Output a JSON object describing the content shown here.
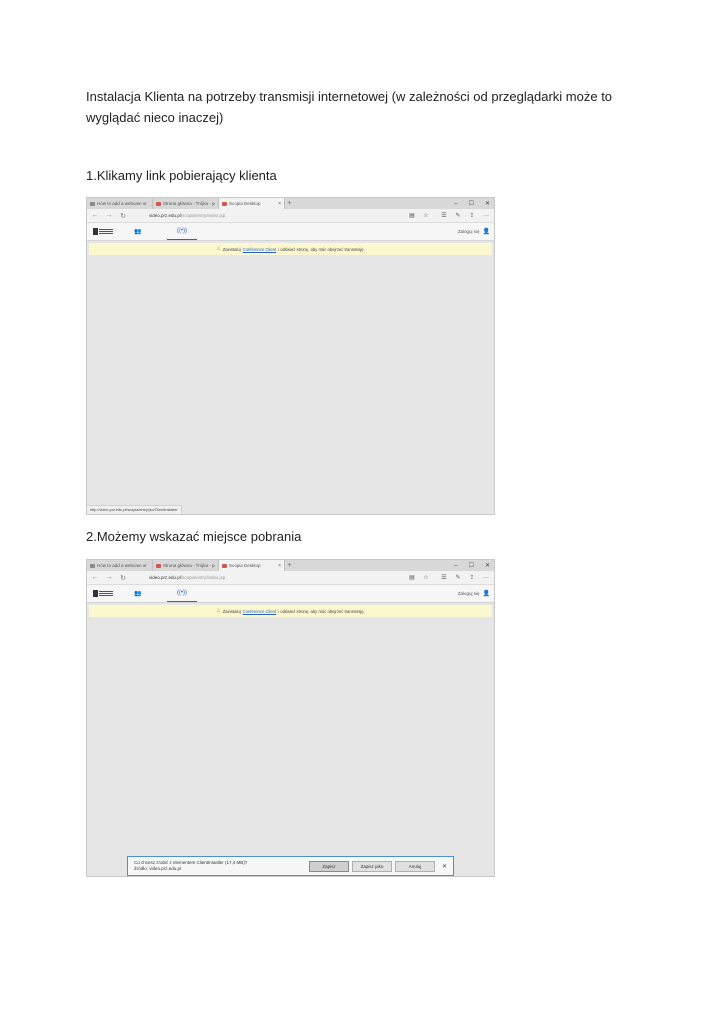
{
  "intro": "Instalacja Klienta na potrzeby transmisji internetowej (w zależności od przeglądarki może to wyglądać nieco inaczej)",
  "steps": [
    {
      "heading": "1.Klikamy link pobierający klienta",
      "tabs": [
        "How to add a webcam or",
        "Strona główna - Trójka - po",
        "Scopia Desktop"
      ],
      "tab_close": "×",
      "new_tab": "+",
      "window_controls": [
        "–",
        "☐",
        "✕"
      ],
      "url_host": "video.prz.edu.pl",
      "url_path": "/scopia/entry/index.jsp",
      "login": "Zaloguj się",
      "notice_before": "Zainstaluj",
      "notice_link": "Conference Client",
      "notice_after": "i odśwież stronę, aby móc obejrzeć transmisję.",
      "status": "http://video.prz.edu.pl/scopia/entry/jsc/ClientInstaller"
    },
    {
      "heading": "2.Możemy wskazać miejsce pobrania",
      "tabs": [
        "How to add a webcam or",
        "Strona główna - Trójka - po",
        "Scopia Desktop"
      ],
      "tab_close": "×",
      "new_tab": "+",
      "window_controls": [
        "–",
        "☐",
        "✕"
      ],
      "url_host": "video.prz.edu.pl",
      "url_path": "/scopia/entry/index.jsp",
      "login": "Zaloguj się",
      "notice_before": "Zainstaluj",
      "notice_link": "Conference Client",
      "notice_after": "i odśwież stronę, aby móc obejrzeć transmisję.",
      "download": {
        "question": "Co chcesz zrobić z elementem ClientInstaller (17,4 MB)?",
        "source": "Źródło: video.prz.edu.pl",
        "open_label": "Zapisz",
        "save_as_label": "Zapisz jako",
        "cancel_label": "Anuluj",
        "close": "✕"
      }
    }
  ],
  "icons": {
    "back": "←",
    "forward": "→",
    "refresh": "↻",
    "reading": "▤",
    "favorite": "☆",
    "hub": "☰",
    "note": "✎",
    "share": "⇪",
    "more": "···",
    "people": "👥",
    "live": "((•))",
    "person": "👤",
    "warning": "⚠"
  }
}
